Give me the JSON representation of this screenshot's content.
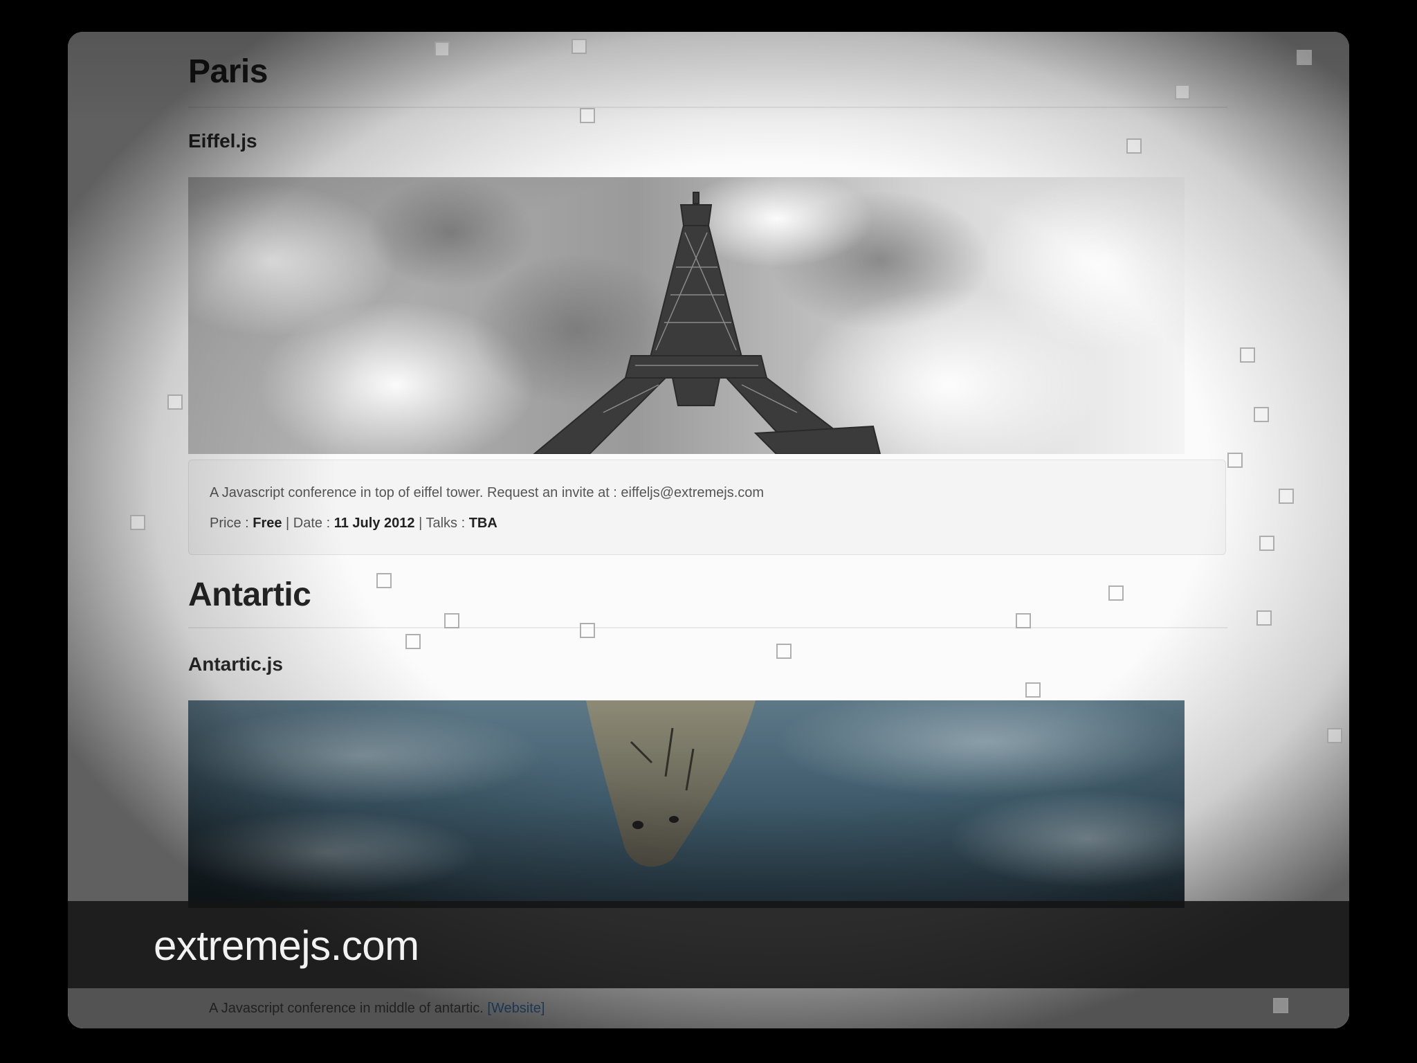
{
  "sections": [
    {
      "city": "Paris",
      "conference": "Eiffel.js",
      "description": "A Javascript conference in top of eiffel tower. Request an invite at : eiffeljs@extremejs.com",
      "price_label": "Price : ",
      "price": "Free",
      "date_label": " | Date : ",
      "date": "11 July 2012",
      "talks_label": " | Talks : ",
      "talks": "TBA",
      "image": "eiffel-tower-photo"
    },
    {
      "city": "Antartic",
      "conference": "Antartic.js",
      "description": "A Javascript conference in middle of antartic. ",
      "link_open": "[",
      "link_text": "Website",
      "link_close": "]",
      "image": "seal-under-ice-photo"
    }
  ],
  "caption": "extremejs.com",
  "colors": {
    "background": "#000000",
    "page": "#fbfbfb",
    "link": "#3a7ab8",
    "caption_bar": "#141414"
  }
}
